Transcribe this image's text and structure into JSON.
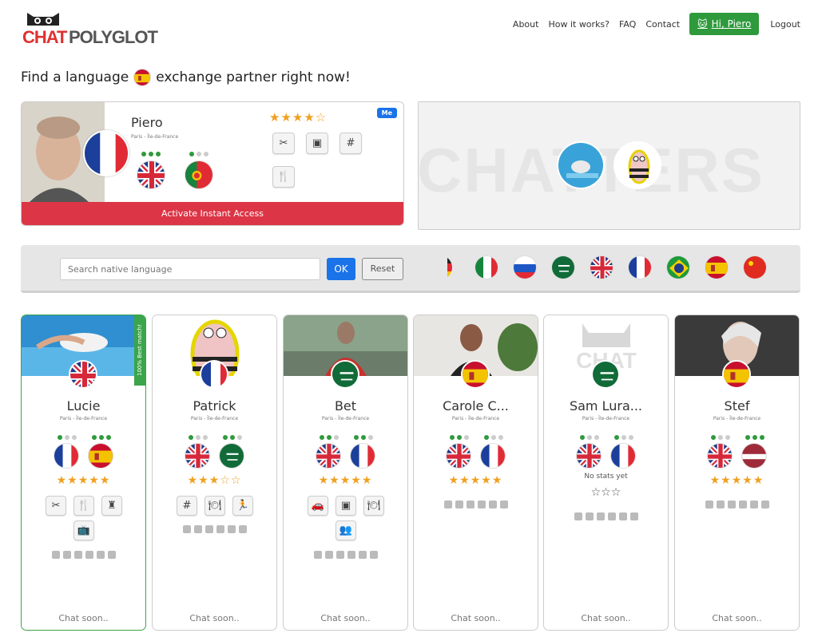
{
  "brand": {
    "part1": "CHAT",
    "part2": "POLYGLOT"
  },
  "nav": {
    "about": "About",
    "how": "How it works?",
    "faq": "FAQ",
    "contact": "Contact",
    "hi": "Hi, Piero",
    "logout": "Logout"
  },
  "tagline": {
    "before": "Find a language",
    "after": "exchange partner right now!"
  },
  "me": {
    "name": "Piero",
    "location": "Paris - Île-de-France",
    "badge": "Me",
    "stars": "★★★★☆",
    "activate": "Activate Instant Access"
  },
  "chatters": {
    "text": "CHATTERS"
  },
  "search": {
    "placeholder": "Search native language",
    "ok": "OK",
    "reset": "Reset"
  },
  "filter_flags": [
    "germany-flag",
    "italy-flag",
    "russia-flag",
    "saudi-arabia-flag",
    "uk-flag",
    "france-flag",
    "brazil-flag",
    "spain-flag",
    "china-flag"
  ],
  "cards": [
    {
      "name": "Lucie",
      "location": "Paris - Île-de-France",
      "stars": "★★★★★",
      "chat": "Chat soon..",
      "best": "100% Best match!"
    },
    {
      "name": "Patrick",
      "location": "Paris - Île-de-France",
      "stars": "★★★☆☆",
      "chat": "Chat soon.."
    },
    {
      "name": "Bet",
      "location": "Paris - Île-de-France",
      "stars": "★★★★★",
      "chat": "Chat soon.."
    },
    {
      "name": "Carole C...",
      "location": "Paris - Île-de-France",
      "stars": "★★★★★",
      "chat": "Chat soon.."
    },
    {
      "name": "Sam Lura...",
      "location": "Paris - Île-de-France",
      "stars": "☆☆☆",
      "nostats": "No stats yet",
      "chat": "Chat soon.."
    },
    {
      "name": "Stef",
      "location": "Paris - Île-de-France",
      "stars": "★★★★★",
      "chat": "Chat soon.."
    }
  ],
  "colors": {
    "accent_green": "#2e9a3c",
    "accent_blue": "#1a73e8",
    "danger_red": "#dc3545",
    "brand_red": "#e03131",
    "star": "#f0a020"
  }
}
